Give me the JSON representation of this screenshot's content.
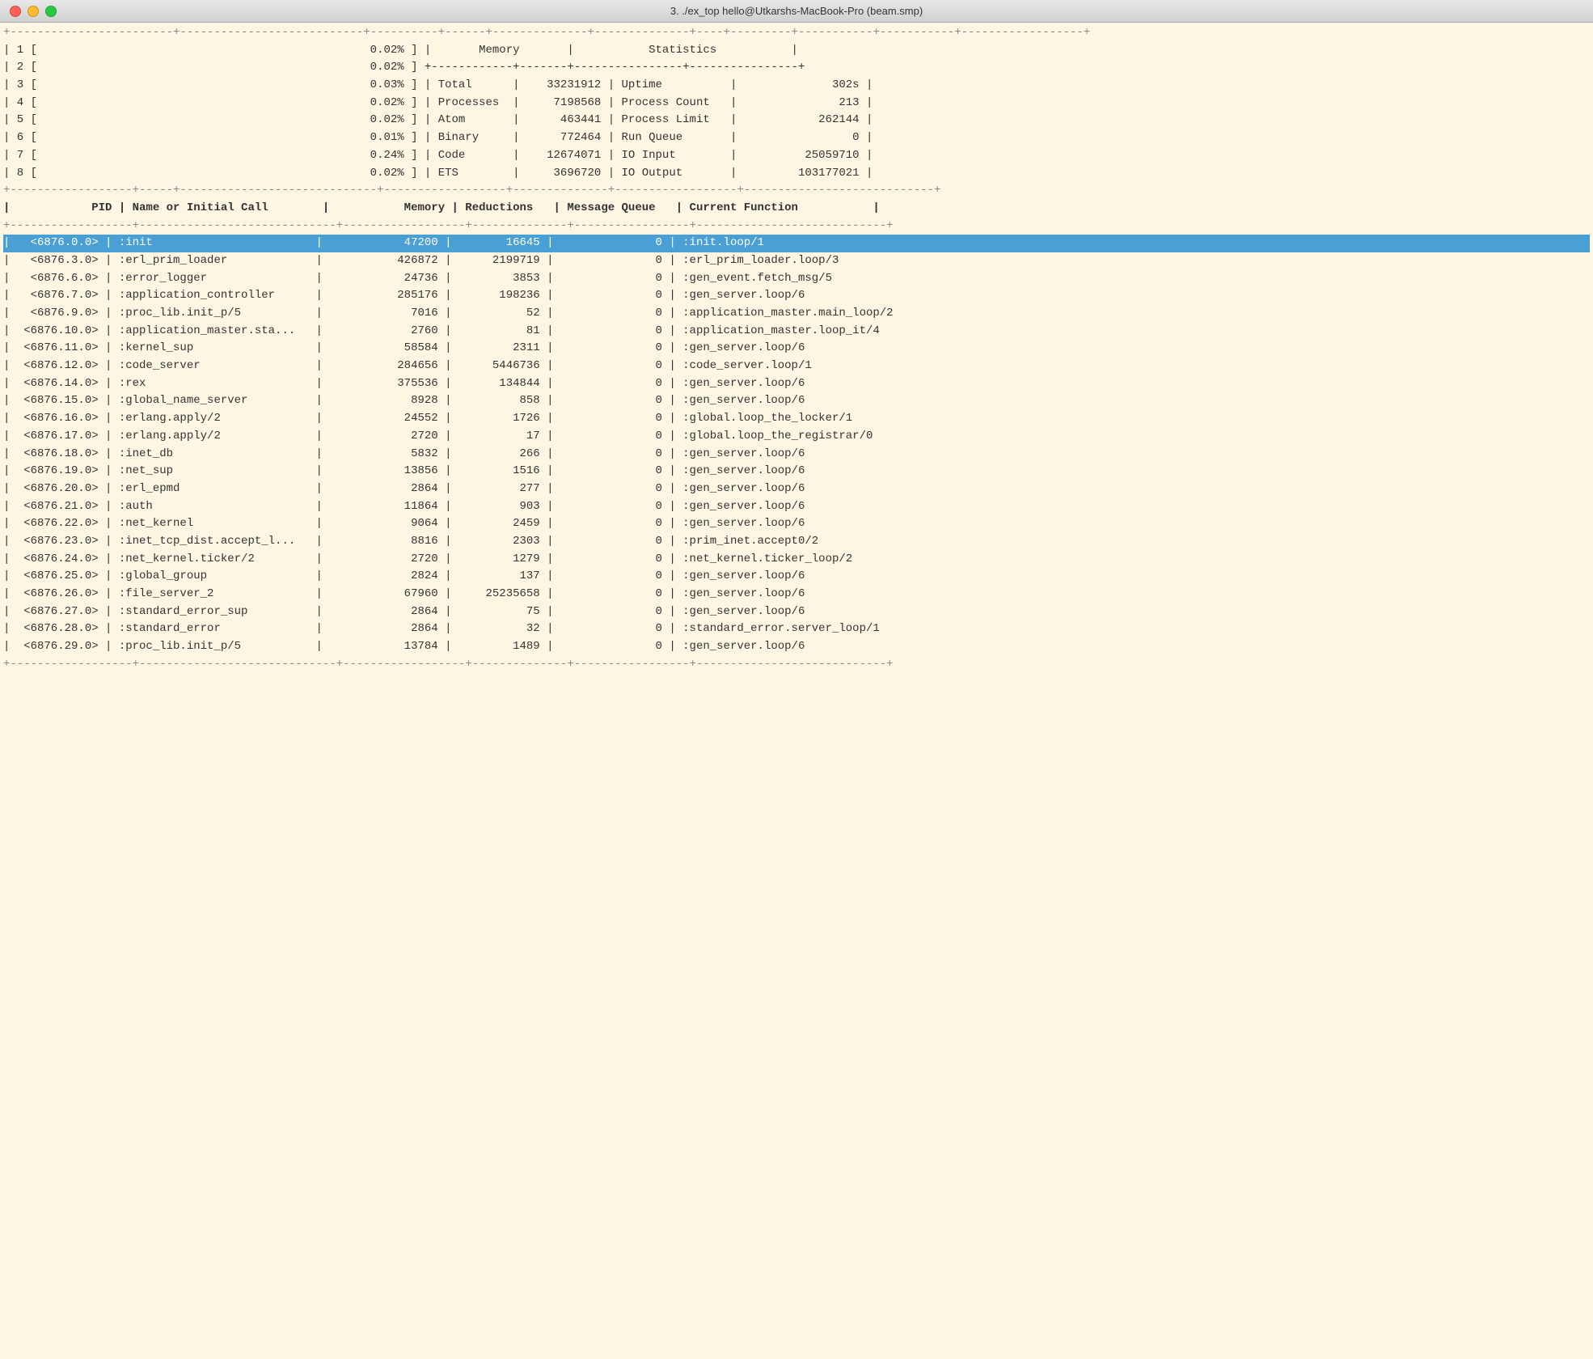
{
  "titleBar": {
    "title": "3. ./ex_top hello@Utkarshs-MacBook-Pro (beam.smp)"
  },
  "terminal": {
    "topSection": {
      "dashedTop": "+----------------------------------------------------------------------------------------+------------------+------------------------+------------------+",
      "line1": "| 1 [                                                 0.02% ] |       Memory       |           Statistics           |",
      "line2": "| 2 [                                                 0.02% ] +------------+-------+----------------+----------------+",
      "line3": "| 3 [                                                 0.03% ] | Total      |    33231912 | Uptime          |              302s |",
      "line4": "| 4 [                                                 0.02% ] | Processes  |     7198568 | Process Count   |               213 |",
      "line5": "| 5 [                                                 0.02% ] | Atom       |      463441 | Process Limit   |            262144 |",
      "line6": "| 6 [                                                 0.01% ] | Binary     |      772464 | Run Queue       |                 0 |",
      "line7": "| 7 [                                                 0.24% ] | Code       |    12674071 | IO Input        |          25059710 |",
      "line8": "| 8 [                                                 0.02% ] | ETS        |     3696720 | IO Output       |         103177021 |"
    },
    "columnHeader": {
      "dashedMid": "+----------------+-----------------------------+------------------+--------------+-----------------+----------------------------+",
      "header": "|            PID | Name or Initial Call        |           Memory | Reductions   | Message Queue   | Current Function           |",
      "dashedBot": "+----------------+-----------------------------+------------------+--------------+-----------------+----------------------------+"
    },
    "processes": [
      {
        "highlight": true,
        "pid": "<6876.0.0>",
        "name": ":init",
        "memory": "47200",
        "reductions": "16645",
        "mq": "0",
        "func": ":init.loop/1"
      },
      {
        "highlight": false,
        "pid": "<6876.3.0>",
        "name": ":erl_prim_loader",
        "memory": "426872",
        "reductions": "2199719",
        "mq": "0",
        "func": ":erl_prim_loader.loop/3"
      },
      {
        "highlight": false,
        "pid": "<6876.6.0>",
        "name": ":error_logger",
        "memory": "24736",
        "reductions": "3853",
        "mq": "0",
        "func": ":gen_event.fetch_msg/5"
      },
      {
        "highlight": false,
        "pid": "<6876.7.0>",
        "name": ":application_controller",
        "memory": "285176",
        "reductions": "198236",
        "mq": "0",
        "func": ":gen_server.loop/6"
      },
      {
        "highlight": false,
        "pid": "<6876.9.0>",
        "name": ":proc_lib.init_p/5",
        "memory": "7016",
        "reductions": "52",
        "mq": "0",
        "func": ":application_master.main_loop/2"
      },
      {
        "highlight": false,
        "pid": "<6876.10.0>",
        "name": ":application_master.sta...",
        "memory": "2760",
        "reductions": "81",
        "mq": "0",
        "func": ":application_master.loop_it/4"
      },
      {
        "highlight": false,
        "pid": "<6876.11.0>",
        "name": ":kernel_sup",
        "memory": "58584",
        "reductions": "2311",
        "mq": "0",
        "func": ":gen_server.loop/6"
      },
      {
        "highlight": false,
        "pid": "<6876.12.0>",
        "name": ":code_server",
        "memory": "284656",
        "reductions": "5446736",
        "mq": "0",
        "func": ":code_server.loop/1"
      },
      {
        "highlight": false,
        "pid": "<6876.14.0>",
        "name": ":rex",
        "memory": "375536",
        "reductions": "134844",
        "mq": "0",
        "func": ":gen_server.loop/6"
      },
      {
        "highlight": false,
        "pid": "<6876.15.0>",
        "name": ":global_name_server",
        "memory": "8928",
        "reductions": "858",
        "mq": "0",
        "func": ":gen_server.loop/6"
      },
      {
        "highlight": false,
        "pid": "<6876.16.0>",
        "name": ":erlang.apply/2",
        "memory": "24552",
        "reductions": "1726",
        "mq": "0",
        "func": ":global.loop_the_locker/1"
      },
      {
        "highlight": false,
        "pid": "<6876.17.0>",
        "name": ":erlang.apply/2",
        "memory": "2720",
        "reductions": "17",
        "mq": "0",
        "func": ":global.loop_the_registrar/0"
      },
      {
        "highlight": false,
        "pid": "<6876.18.0>",
        "name": ":inet_db",
        "memory": "5832",
        "reductions": "266",
        "mq": "0",
        "func": ":gen_server.loop/6"
      },
      {
        "highlight": false,
        "pid": "<6876.19.0>",
        "name": ":net_sup",
        "memory": "13856",
        "reductions": "1516",
        "mq": "0",
        "func": ":gen_server.loop/6"
      },
      {
        "highlight": false,
        "pid": "<6876.20.0>",
        "name": ":erl_epmd",
        "memory": "2864",
        "reductions": "277",
        "mq": "0",
        "func": ":gen_server.loop/6"
      },
      {
        "highlight": false,
        "pid": "<6876.21.0>",
        "name": ":auth",
        "memory": "11864",
        "reductions": "903",
        "mq": "0",
        "func": ":gen_server.loop/6"
      },
      {
        "highlight": false,
        "pid": "<6876.22.0>",
        "name": ":net_kernel",
        "memory": "9064",
        "reductions": "2459",
        "mq": "0",
        "func": ":gen_server.loop/6"
      },
      {
        "highlight": false,
        "pid": "<6876.23.0>",
        "name": ":inet_tcp_dist.accept_l...",
        "memory": "8816",
        "reductions": "2303",
        "mq": "0",
        "func": ":prim_inet.accept0/2"
      },
      {
        "highlight": false,
        "pid": "<6876.24.0>",
        "name": ":net_kernel.ticker/2",
        "memory": "2720",
        "reductions": "1279",
        "mq": "0",
        "func": ":net_kernel.ticker_loop/2"
      },
      {
        "highlight": false,
        "pid": "<6876.25.0>",
        "name": ":global_group",
        "memory": "2824",
        "reductions": "137",
        "mq": "0",
        "func": ":gen_server.loop/6"
      },
      {
        "highlight": false,
        "pid": "<6876.26.0>",
        "name": ":file_server_2",
        "memory": "67960",
        "reductions": "25235658",
        "mq": "0",
        "func": ":gen_server.loop/6"
      },
      {
        "highlight": false,
        "pid": "<6876.27.0>",
        "name": ":standard_error_sup",
        "memory": "2864",
        "reductions": "75",
        "mq": "0",
        "func": ":gen_server.loop/6"
      },
      {
        "highlight": false,
        "pid": "<6876.28.0>",
        "name": ":standard_error",
        "memory": "2864",
        "reductions": "32",
        "mq": "0",
        "func": ":standard_error.server_loop/1"
      },
      {
        "highlight": false,
        "pid": "<6876.29.0>",
        "name": ":proc_lib.init_p/5",
        "memory": "13784",
        "reductions": "1489",
        "mq": "0",
        "func": ":gen_server.loop/6"
      }
    ],
    "dashedBottom": "+----------------+-----------------------------+------------------+--------------+-----------------+----------------------------+"
  }
}
